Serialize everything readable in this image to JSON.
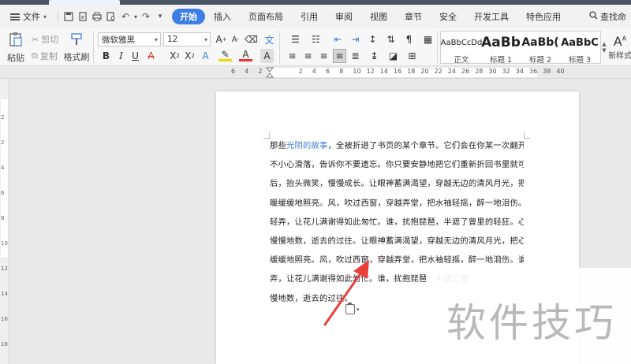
{
  "menu": {
    "file_label": "文件",
    "tabs": [
      "开始",
      "插入",
      "页面布局",
      "引用",
      "审阅",
      "视图",
      "章节",
      "安全",
      "开发工具",
      "特色应用"
    ],
    "active_tab": "开始",
    "search_label": "查找命"
  },
  "ribbon": {
    "paste_label": "粘贴",
    "cut_label": "剪切",
    "copy_label": "复制",
    "format_painter_label": "格式刷",
    "font_name": "微软雅黑",
    "font_size": "12",
    "styles": [
      {
        "sample": "AaBbCcDd",
        "name": "正文"
      },
      {
        "sample": "AaBb",
        "name": "标题 1"
      },
      {
        "sample": "AaBb(",
        "name": "标题 2"
      },
      {
        "sample": "AaBbC",
        "name": "标题 3"
      }
    ],
    "new_style_label": "新样式"
  },
  "ruler": {
    "numbers": [
      "6",
      "4",
      "2",
      "2",
      "4",
      "6",
      "8",
      "10",
      "12",
      "14",
      "16",
      "18",
      "20",
      "22",
      "24",
      "26",
      "28",
      "30",
      "32",
      "34",
      "36",
      "38",
      "40"
    ]
  },
  "vruler": {
    "numbers": [
      "2",
      "2",
      "4",
      "6",
      "8",
      "10",
      "12",
      "14",
      "16",
      "18"
    ]
  },
  "document": {
    "line1_pre": "那些",
    "line1_link": "光阴的故事",
    "line1_post": "，全被折进了书页的某个章节。它们会在你某一次翻开书的时候",
    "lines": [
      "不小心滑落，告诉你不要遗忘。你只要安静地把它们重新折回书里就可以了。然",
      "后，抬头微笑，慢慢成长。让眼神蓄满渴望，穿越无边的清风月光，把心，用温",
      "暖缓缓地照亮。风，吹过西窗，穿越弄堂，把水袖轻摇，醉一地泪伤。谁，起舞",
      "轻弄，让花儿满谢得如此匆忙。谁，扰抱琵琶，半遮了曾里的轻狂。心，失落，",
      "慢慢地数，逝去的过往。让眼神蓄满渴望，穿越无边的清风月光，把心，用温暖",
      "缓缓地照亮。风，吹过西窗，穿越弄堂，把水袖轻摇，醉一地泪伤。谁，起舞轻",
      "弄，让花儿满谢得如此匆忙。谁，扰抱琵琶，半遮了曾",
      "慢地数，逝去的过往。"
    ]
  },
  "watermark": "软件技巧",
  "colors": {
    "accent": "#3d7de4",
    "link": "#3b7fd9",
    "arrow": "#e8403a"
  }
}
